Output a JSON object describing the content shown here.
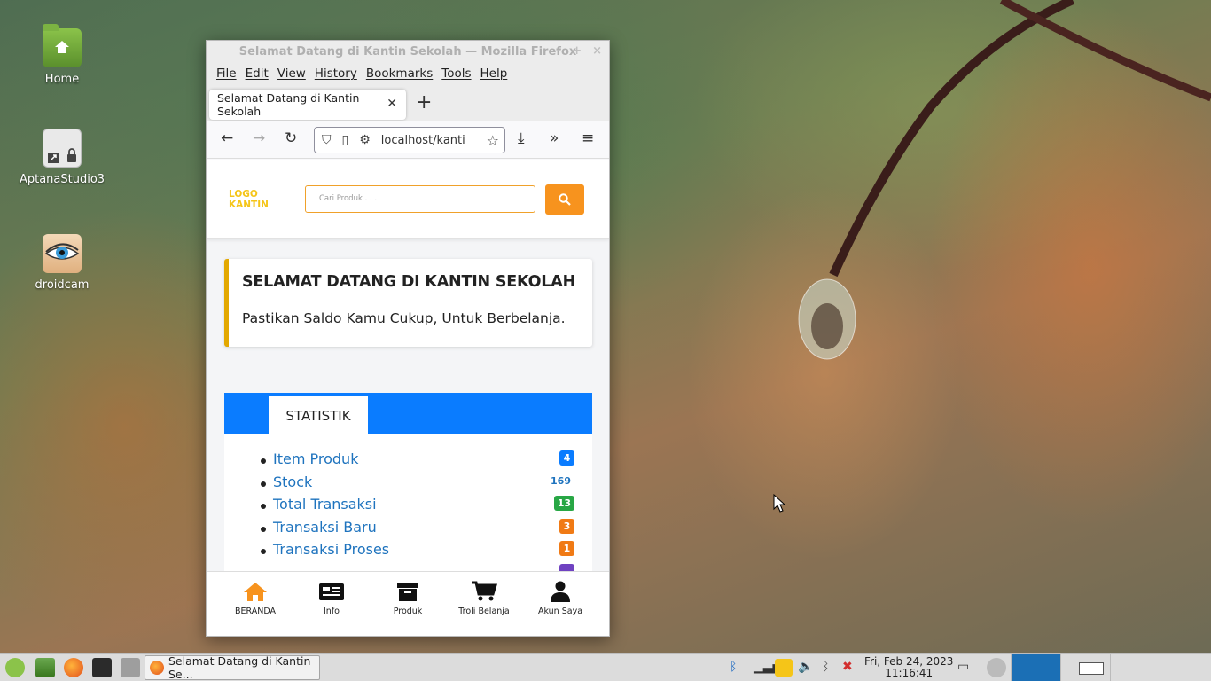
{
  "desktop": {
    "icons": [
      {
        "label": "Home"
      },
      {
        "label": "AptanaStudio3"
      },
      {
        "label": "droidcam"
      }
    ]
  },
  "window": {
    "title": "Selamat Datang di Kantin Sekolah — Mozilla Firefox",
    "menu": [
      "File",
      "Edit",
      "View",
      "History",
      "Bookmarks",
      "Tools",
      "Help"
    ],
    "tab_title": "Selamat Datang di Kantin Sekolah",
    "url": "localhost/kantin"
  },
  "page": {
    "logo_line1": "LOGO",
    "logo_line2": "KANTIN",
    "search_placeholder": "Cari Produk . . .",
    "welcome_title": "SELAMAT DATANG DI KANTIN SEKOLAH",
    "welcome_text": "Pastikan Saldo Kamu Cukup, Untuk Berbelanja.",
    "stats_tab": "STATISTIK",
    "stats": [
      {
        "label": "Item Produk",
        "value": "4",
        "color": "#0a7cff"
      },
      {
        "label": "Stock",
        "value": "169",
        "color": "#1e73be"
      },
      {
        "label": "Total Transaksi",
        "value": "13",
        "color": "#28a745"
      },
      {
        "label": "Transaksi Baru",
        "value": "3",
        "color": "#f07a15"
      },
      {
        "label": "Transaksi Proses",
        "value": "1",
        "color": "#f07a15"
      }
    ],
    "bottom_nav": [
      {
        "label": "BERANDA",
        "icon": "home-icon",
        "active": true
      },
      {
        "label": "Info",
        "icon": "newspaper-icon"
      },
      {
        "label": "Produk",
        "icon": "archive-box-icon"
      },
      {
        "label": "Troli Belanja",
        "icon": "cart-icon"
      },
      {
        "label": "Akun Saya",
        "icon": "user-icon"
      }
    ]
  },
  "taskbar": {
    "task_label": "Selamat Datang di Kantin Se...",
    "date": "Fri, Feb 24, 2023",
    "time": "11:16:41"
  }
}
